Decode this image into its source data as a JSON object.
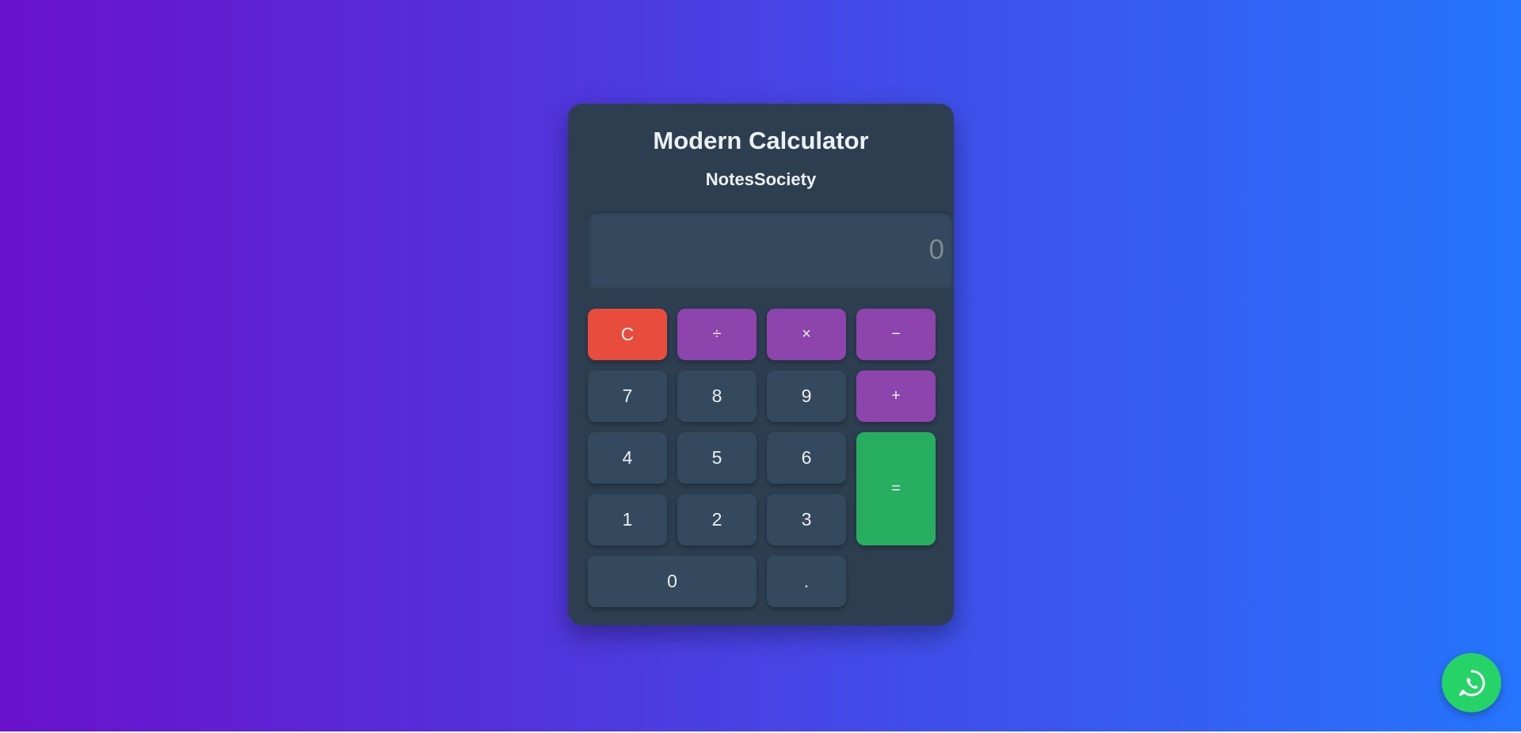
{
  "app": {
    "title": "Modern Calculator",
    "subtitle": "NotesSociety"
  },
  "display": {
    "value": "",
    "placeholder": "0"
  },
  "keys": {
    "clear": "C",
    "divide": "÷",
    "multiply": "×",
    "subtract": "−",
    "seven": "7",
    "eight": "8",
    "nine": "9",
    "add": "+",
    "four": "4",
    "five": "5",
    "six": "6",
    "equals": "=",
    "one": "1",
    "two": "2",
    "three": "3",
    "zero": "0",
    "decimal": "."
  },
  "floating": {
    "icon": "whatsapp-icon"
  },
  "colors": {
    "background_start": "#6a11cb",
    "background_end": "#2575fc",
    "panel": "#2c3e50",
    "key": "#34495e",
    "operator": "#8e44ad",
    "clear": "#e74c3c",
    "equals": "#27ae60",
    "whatsapp": "#25d366"
  }
}
